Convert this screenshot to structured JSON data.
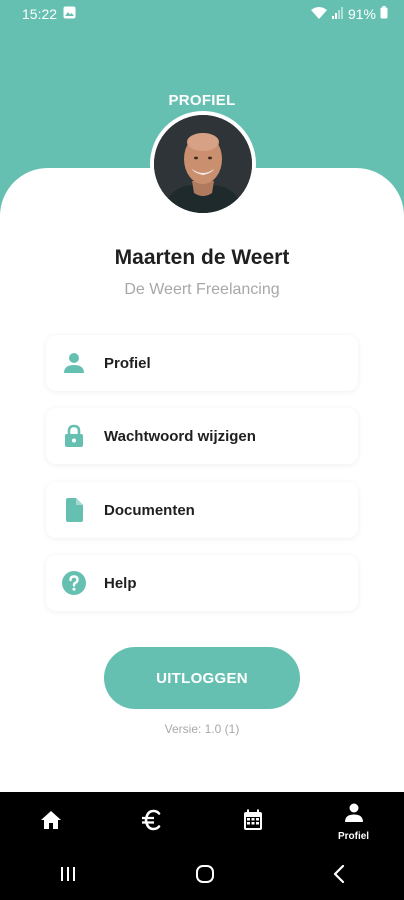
{
  "colors": {
    "accent": "#66c0b1",
    "text": "#1f1f1f",
    "muted": "#a8a8a8",
    "nav_bg": "#000000"
  },
  "status_bar": {
    "time": "15:22",
    "battery": "91%",
    "icons": [
      "image-icon",
      "wifi-icon",
      "signal-icon",
      "battery-icon"
    ]
  },
  "header": {
    "title": "PROFIEL"
  },
  "user": {
    "name": "Maarten de Weert",
    "company": "De Weert Freelancing"
  },
  "menu": [
    {
      "label": "Profiel",
      "icon": "person-icon"
    },
    {
      "label": "Wachtwoord wijzigen",
      "icon": "lock-icon"
    },
    {
      "label": "Documenten",
      "icon": "document-icon"
    },
    {
      "label": "Help",
      "icon": "help-icon"
    }
  ],
  "logout_label": "UITLOGGEN",
  "version": "Versie: 1.0 (1)",
  "bottom_nav": [
    {
      "label": "",
      "icon": "home-icon"
    },
    {
      "label": "",
      "icon": "euro-icon"
    },
    {
      "label": "",
      "icon": "calendar-icon"
    },
    {
      "label": "Profiel",
      "icon": "person-icon",
      "active": true
    }
  ],
  "system_nav": [
    "recents-icon",
    "home-circle-icon",
    "back-icon"
  ]
}
